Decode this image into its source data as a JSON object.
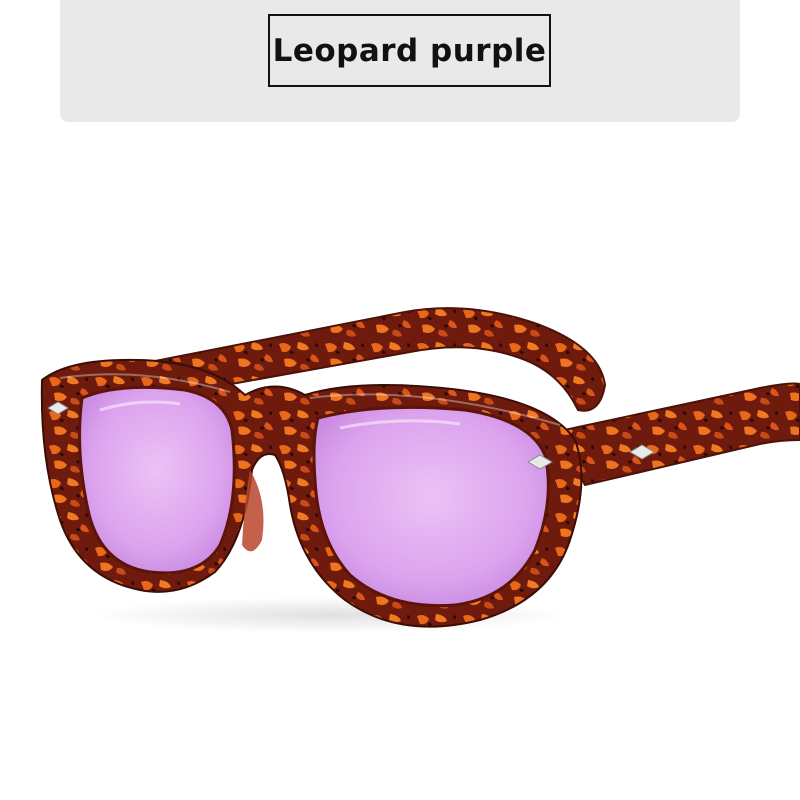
{
  "product_label": "Leopard purple",
  "product_image": {
    "icon": "tortoiseshell-round-sunglasses",
    "frame_color": "#7a1e0e",
    "pattern_color": "#e8681a",
    "lens_color": "#dca3ee"
  }
}
